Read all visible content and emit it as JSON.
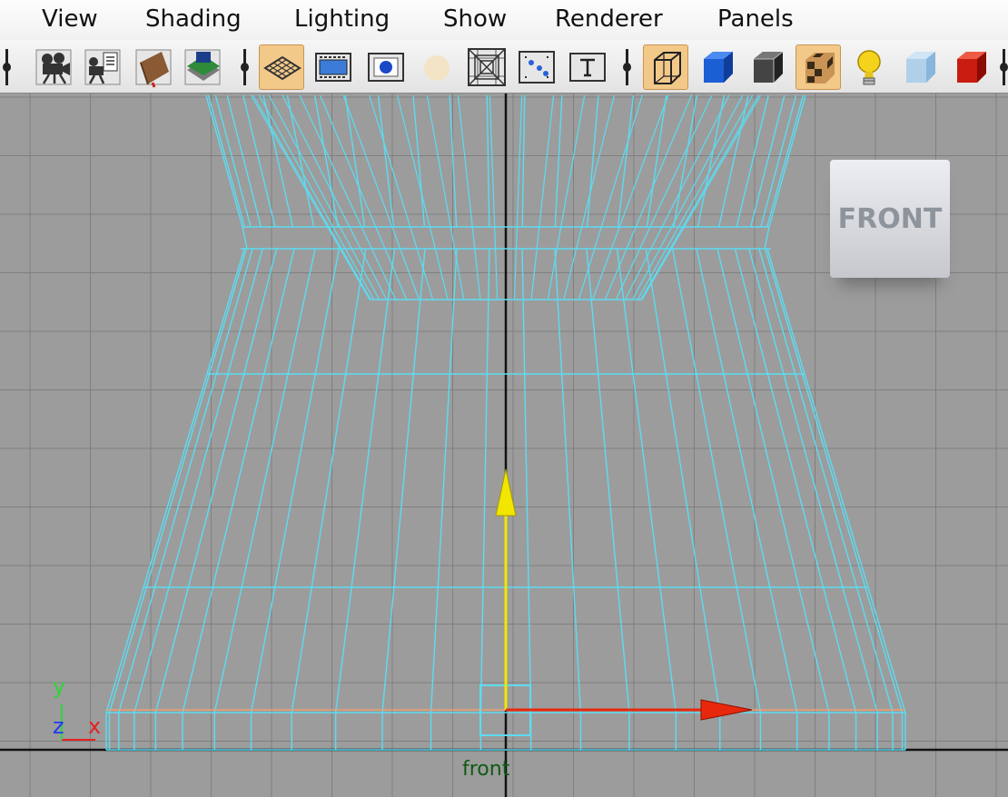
{
  "menu": {
    "view": "View",
    "shading": "Shading",
    "lighting": "Lighting",
    "show": "Show",
    "renderer": "Renderer",
    "panels": "Panels"
  },
  "toolbar": {
    "groups": [
      [
        "select-camera-icon",
        "camera-attributes-icon",
        "bookmarks-icon",
        "image-plane-icon"
      ],
      [
        "grid-icon",
        "film-gate-icon",
        "resolution-gate-icon",
        "safe-action-icon",
        "field-chart-icon",
        "depth-of-field-icon",
        "text-icon"
      ],
      [
        "wireframe-icon",
        "smooth-shade-icon",
        "wireframe-on-shaded-icon",
        "textured-icon",
        "lights-icon",
        "xray-icon",
        "shadows-icon"
      ]
    ],
    "active": [
      "grid-icon",
      "wireframe-icon",
      "textured-icon"
    ]
  },
  "viewport": {
    "camera_name": "front",
    "view_cube_label": "FRONT",
    "axis_labels": {
      "y": "y",
      "z": "z",
      "x": "x"
    },
    "colors": {
      "background": "#9c9c9c",
      "grid": "#7f7f7f",
      "wireframe": "#5cdcf2",
      "y_axis": "#f2e600",
      "x_axis": "#e8280c",
      "origin_line": "#f0a070",
      "axis_y_letter": "#2ed43a",
      "axis_z_letter": "#1e3cf0",
      "axis_x_letter": "#e82020"
    }
  }
}
